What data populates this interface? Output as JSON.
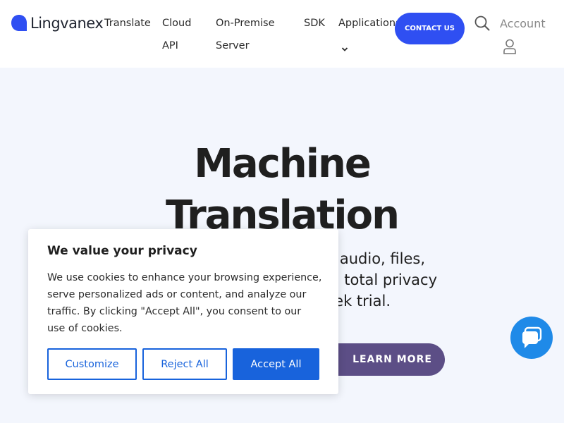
{
  "header": {
    "logo_text": "Lingvanex",
    "nav": [
      {
        "label_1": "Translate",
        "label_2": ""
      },
      {
        "label_1": "Cloud",
        "label_2": "API"
      },
      {
        "label_1": "On-Premise",
        "label_2": "Server"
      },
      {
        "label_1": "SDK",
        "label_2": ""
      },
      {
        "label_1": "Applications",
        "label_2": ""
      }
    ],
    "contact_label": "CONTACT US",
    "account_label": "Account"
  },
  "hero": {
    "title_line1": "Machine",
    "title_line2": "Translation",
    "subtitle_line1": "audio, files,",
    "subtitle_line2": "total privacy",
    "subtitle_line3": "ek trial.",
    "learn_more_label": "LEARN MORE"
  },
  "cookie": {
    "title": "We value your privacy",
    "text": "We use cookies to enhance your browsing experience, serve personalized ads or content, and analyze our traffic. By clicking \"Accept All\", you consent to our use of cookies.",
    "customize_label": "Customize",
    "reject_label": "Reject All",
    "accept_label": "Accept All"
  },
  "colors": {
    "brand_blue": "#2f4ff2",
    "learn_more": "#5c4e86",
    "cookie_blue": "#1863dc",
    "chat_blue": "#1f8ae8",
    "hero_background": "#f3f6fd"
  },
  "icons": {
    "logo": "lingvanex-logo-icon",
    "applications_dropdown": "chevron-down-icon",
    "search": "search-icon",
    "account": "user-icon",
    "chat": "chat-bubble-icon"
  }
}
